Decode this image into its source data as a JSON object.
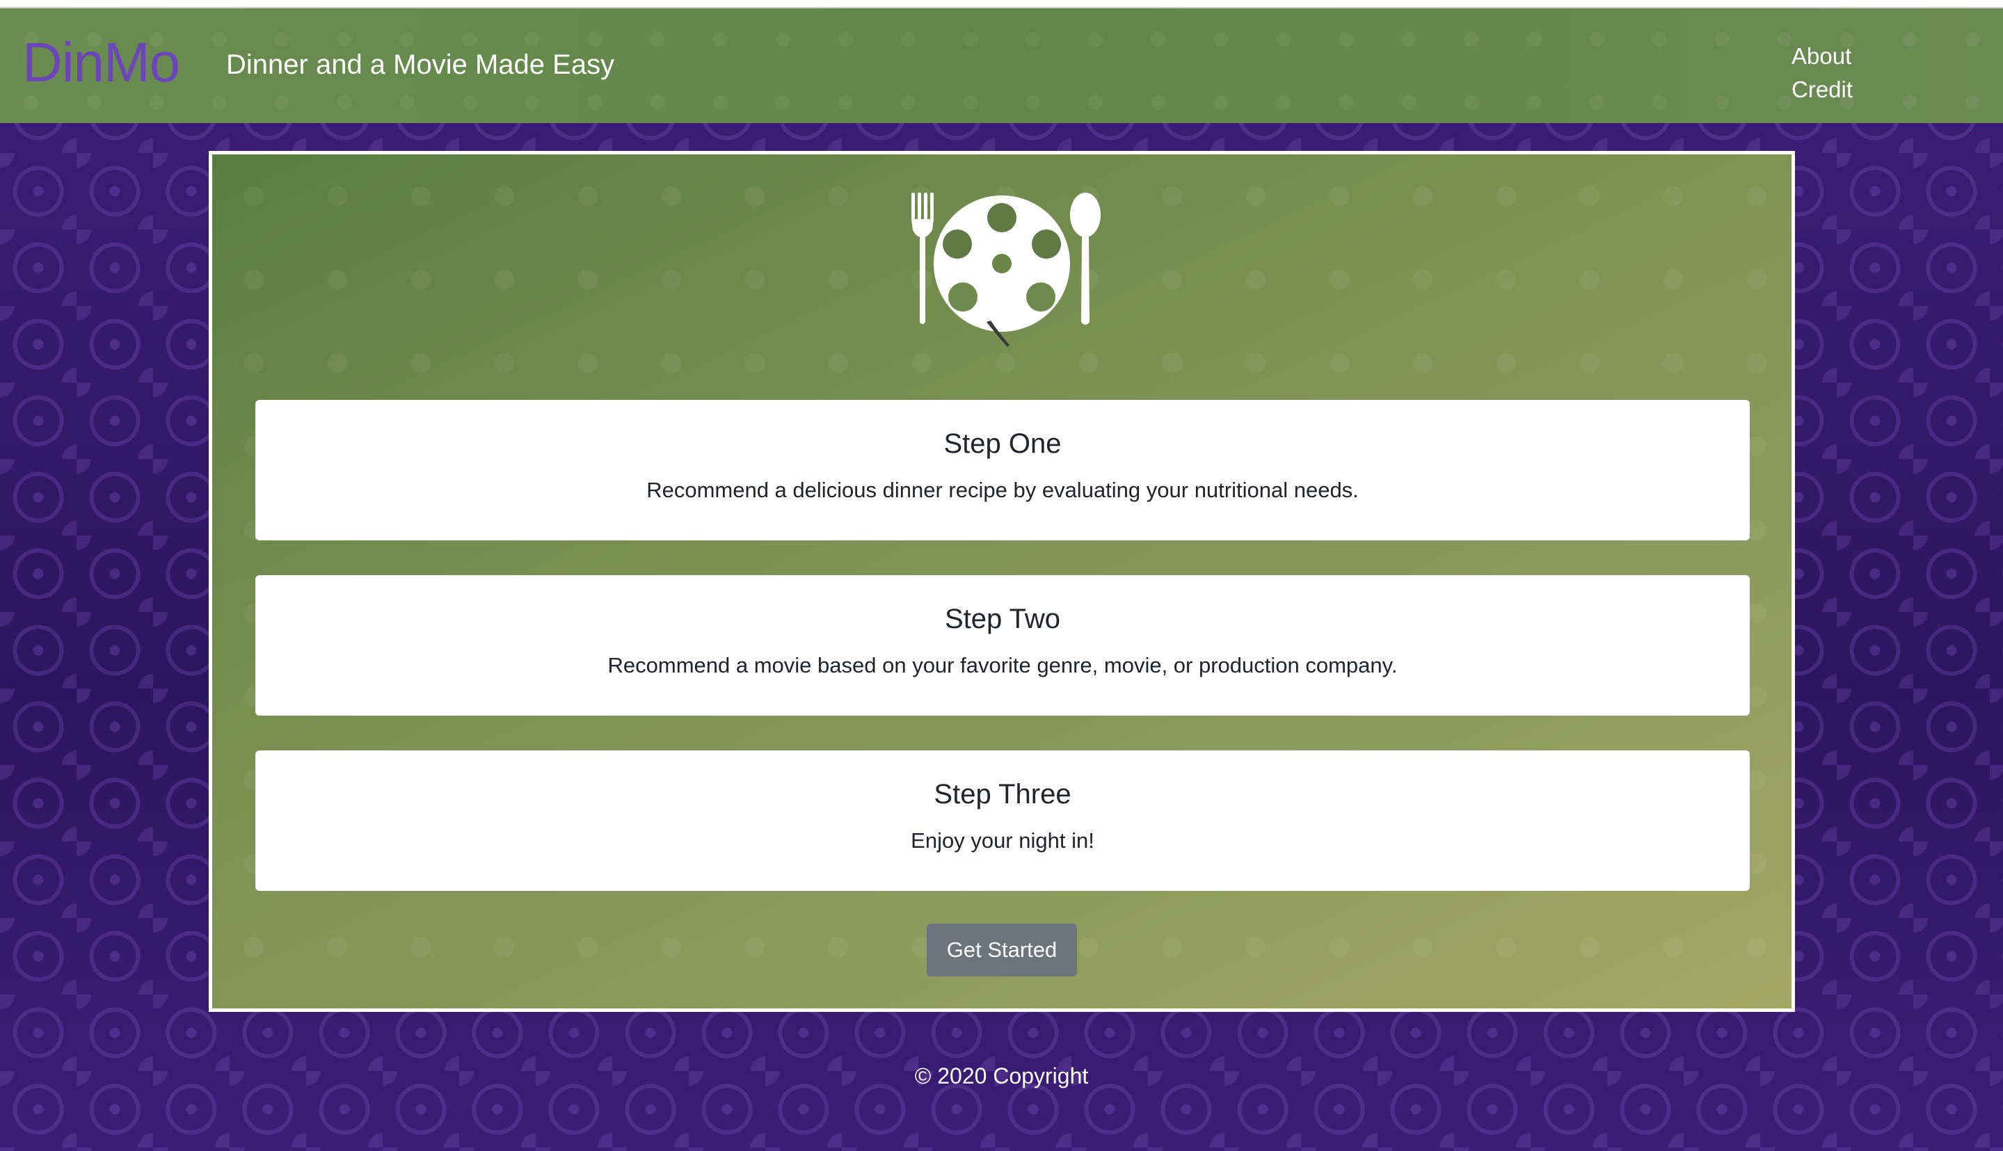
{
  "header": {
    "brand": "DinMo",
    "tagline": "Dinner and a Movie Made Easy",
    "nav": {
      "about": "About",
      "credit": "Credit"
    }
  },
  "main": {
    "logo_icon": "fork-film-reel-spoon-icon",
    "steps": [
      {
        "title": "Step One",
        "description": "Recommend a delicious dinner recipe by evaluating your nutritional needs."
      },
      {
        "title": "Step Two",
        "description": "Recommend a movie based on your favorite genre, movie, or production company."
      },
      {
        "title": "Step Three",
        "description": "Enjoy your night in!"
      }
    ],
    "cta_label": "Get Started"
  },
  "footer": {
    "copyright": "© 2020 Copyright"
  },
  "colors": {
    "header_green": "#66884e",
    "brand_purple": "#6c46b8",
    "background_purple": "#3a1d73",
    "button_gray": "#6c757d",
    "card_white": "#ffffff"
  }
}
